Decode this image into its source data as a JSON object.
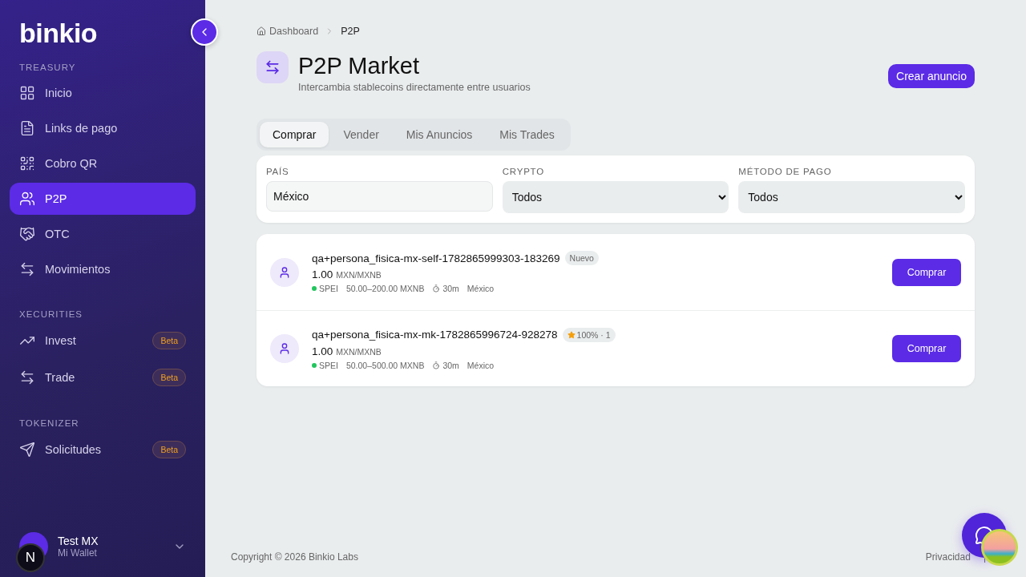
{
  "sidebar": {
    "logo": "binkio",
    "sections": [
      {
        "title": "TREASURY",
        "items": [
          {
            "label": "Inicio",
            "selected": false
          },
          {
            "label": "Links de pago",
            "selected": false
          },
          {
            "label": "Cobro QR",
            "selected": false
          },
          {
            "label": "P2P",
            "selected": true
          },
          {
            "label": "OTC",
            "selected": false
          },
          {
            "label": "Movimientos",
            "selected": false
          }
        ]
      },
      {
        "title": "XECURITIES",
        "items": [
          {
            "label": "Invest",
            "selected": false,
            "badge": "Beta"
          },
          {
            "label": "Trade",
            "selected": false,
            "badge": "Beta"
          }
        ]
      },
      {
        "title": "TOKENIZER",
        "items": [
          {
            "label": "Solicitudes",
            "selected": false,
            "badge": "Beta"
          }
        ]
      }
    ],
    "user": {
      "name": "Test MX",
      "subtitle": "Mi Wallet"
    },
    "dev_badge": "N"
  },
  "breadcrumb": [
    "Dashboard",
    "P2P"
  ],
  "header": {
    "title": "P2P Market",
    "subtitle": "Intercambia stablecoins directamente entre usuarios",
    "action": "Crear anuncio"
  },
  "tabs": [
    {
      "label": "Comprar",
      "selected": true
    },
    {
      "label": "Vender",
      "selected": false
    },
    {
      "label": "Mis Anuncios",
      "selected": false
    },
    {
      "label": "Mis Trades",
      "selected": false
    }
  ],
  "filters": [
    {
      "kind": "input",
      "label": "PAÍS",
      "value": "México"
    },
    {
      "kind": "select",
      "label": "CRYPTO",
      "value": "Todos"
    },
    {
      "kind": "select",
      "label": "MÉTODO DE PAGO",
      "value": "Todos"
    }
  ],
  "offers": [
    {
      "user": "qa+persona_fisica-mx-self-1782865999303-183269",
      "tag": {
        "kind": "new",
        "text": "Nuevo"
      },
      "price": "1.00",
      "pair": "MXN/MXNB",
      "method": "SPEI",
      "limits": "50.00–200.00 MXNB",
      "time": "30m",
      "country": "México",
      "action": "Comprar"
    },
    {
      "user": "qa+persona_fisica-mx-mk-1782865996724-928278",
      "tag": {
        "kind": "rating",
        "text": "100% · 1"
      },
      "price": "1.00",
      "pair": "MXN/MXNB",
      "method": "SPEI",
      "limits": "50.00–500.00 MXNB",
      "time": "30m",
      "country": "México",
      "action": "Comprar"
    }
  ],
  "footer": {
    "copyright": "Copyright © 2026 Binkio Labs",
    "links": [
      "Privacidad",
      "|"
    ]
  }
}
